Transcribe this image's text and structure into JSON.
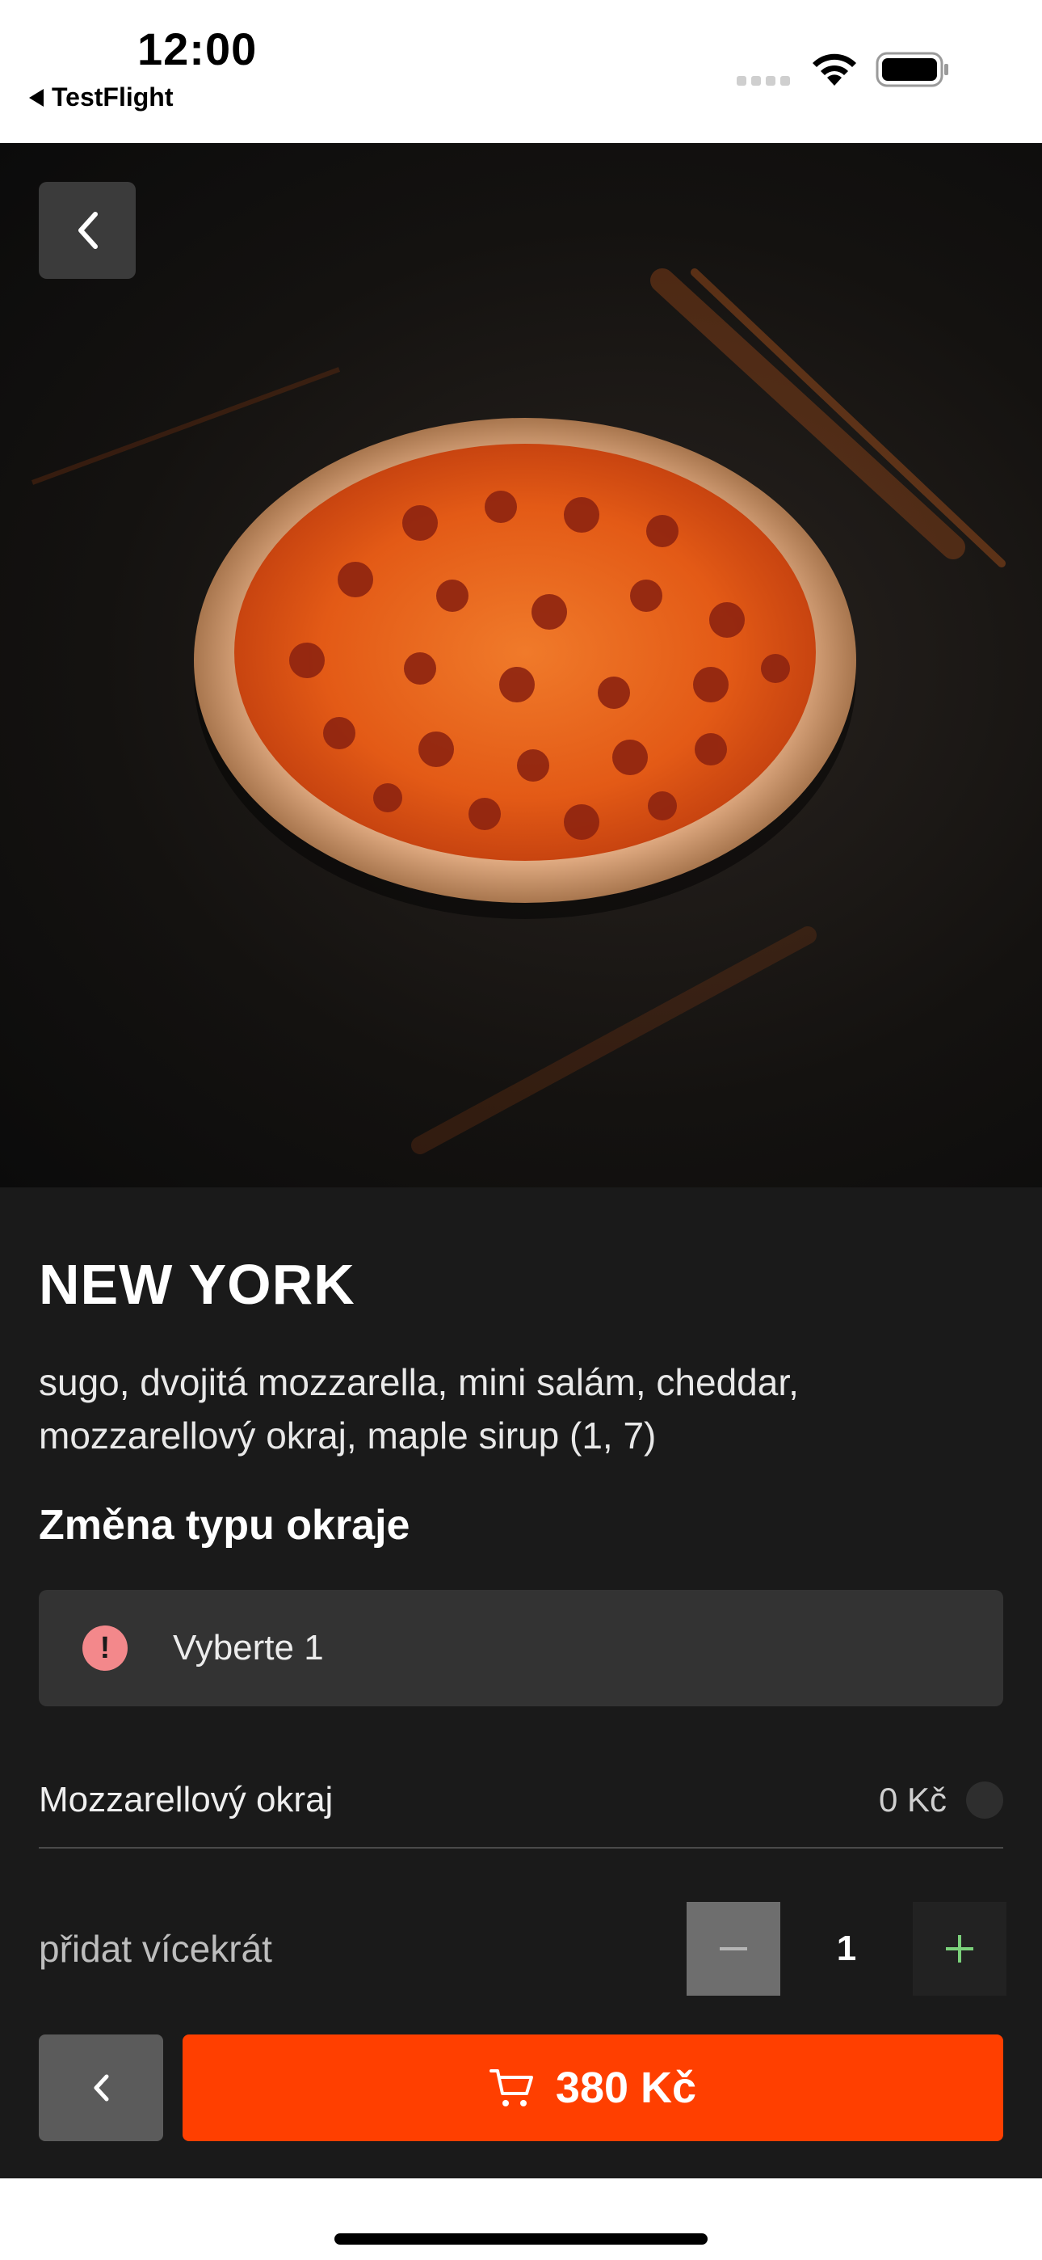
{
  "status_bar": {
    "time": "12:00",
    "back_app": "TestFlight"
  },
  "product": {
    "name": "NEW YORK",
    "description": "sugo, dvojitá mozzarella, mini salám, cheddar, mozzarellový okraj, maple sirup (1, 7)"
  },
  "crust_section": {
    "title": "Změna typu okraje",
    "alert_text": "Vyberte 1",
    "alert_icon": "!",
    "options": [
      {
        "label": "Mozzarellový okraj",
        "price": "0 Kč"
      }
    ]
  },
  "quantity": {
    "label": "přidat vícekrát",
    "value": "1"
  },
  "cart": {
    "price": "380 Kč"
  },
  "colors": {
    "accent": "#ff3f00",
    "alert_icon": "#f3888b",
    "plus_icon": "#7bd17b"
  }
}
